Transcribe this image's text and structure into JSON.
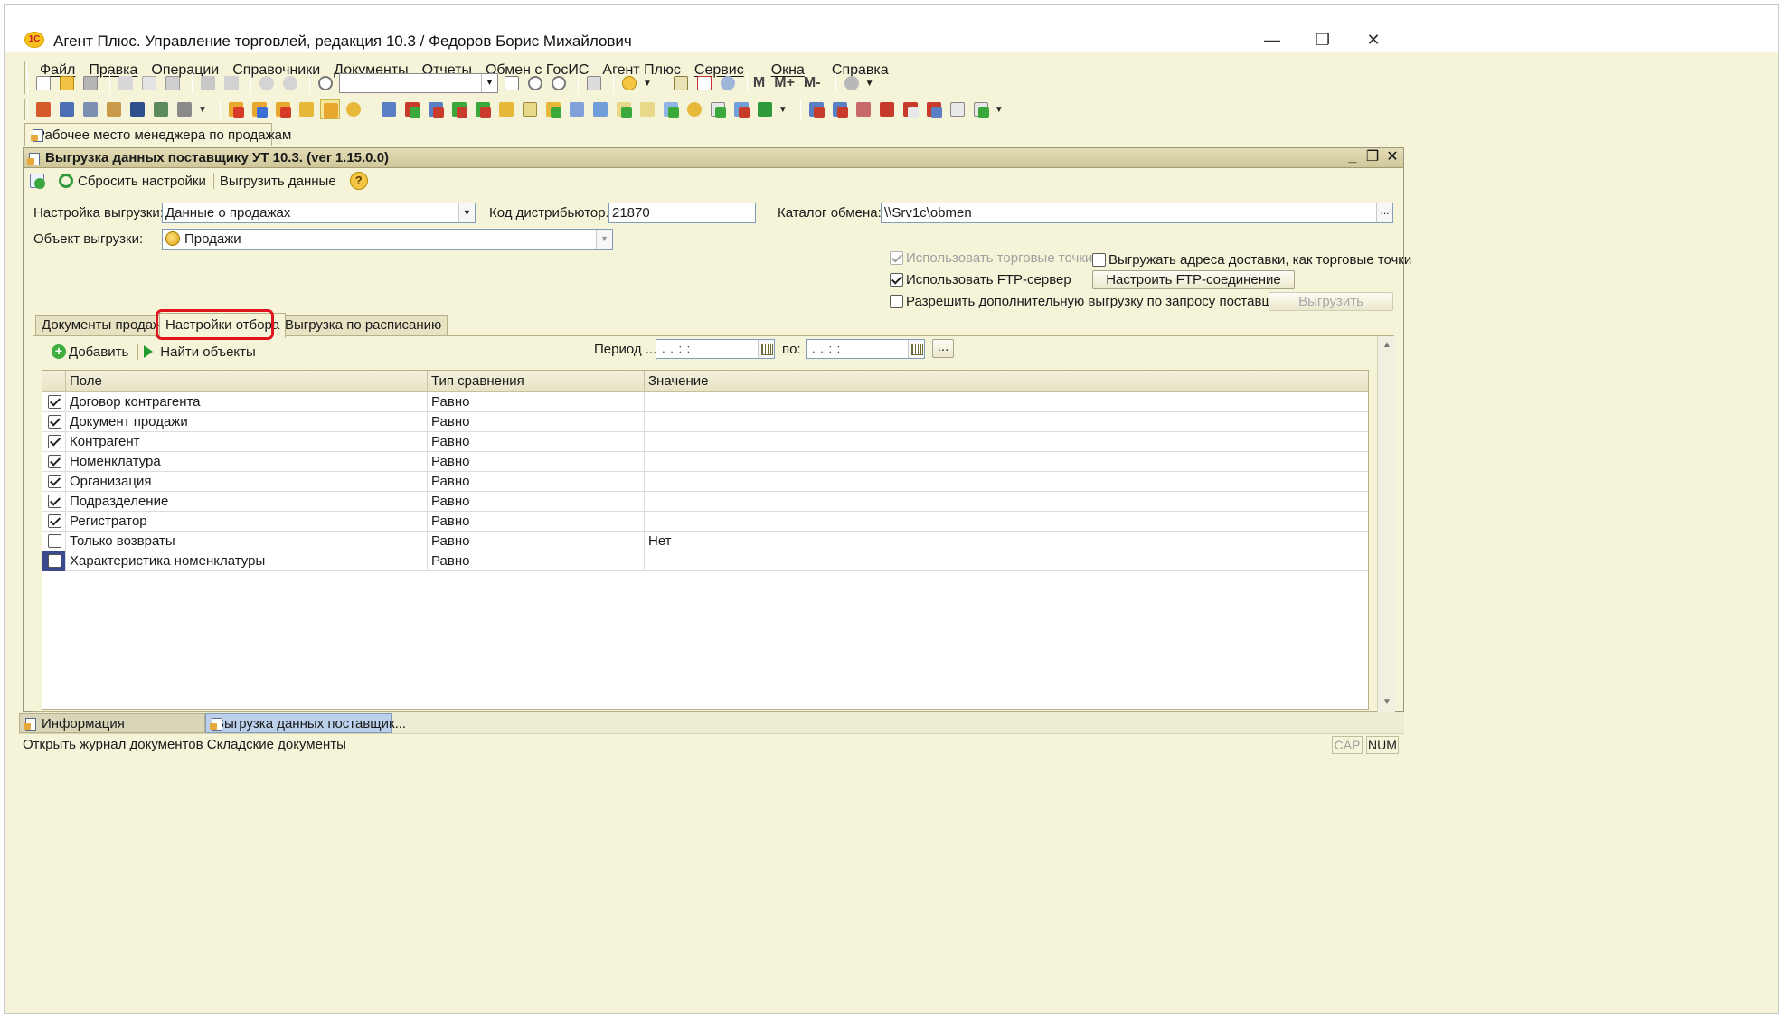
{
  "window": {
    "title": "Агент Плюс. Управление торговлей, редакция 10.3 / Федоров Борис Михайлович",
    "logo": "1С",
    "controls": {
      "minimize": "—",
      "restore": "❐",
      "close": "✕"
    }
  },
  "menu": [
    "Файл",
    "Правка",
    "Операции",
    "Справочники",
    "Документы",
    "Отчеты",
    "Обмен с ГосИС",
    "Агент Плюс",
    "Сервис",
    "Окна",
    "Справка"
  ],
  "toolbar": {
    "m_label": "M",
    "mplus_label": "M+",
    "mminus_label": "M-"
  },
  "open_window_tab": "Рабочее место менеджера по продажам",
  "form": {
    "title": "Выгрузка данных поставщику УТ 10.3. (ver 1.15.0.0)",
    "header_controls": {
      "minimize": "_",
      "restore": "❐",
      "close": "✕"
    },
    "toolbar": {
      "reset": "Сбросить настройки",
      "export": "Выгрузить данные",
      "help": "?"
    },
    "settings": {
      "config_label": "Настройка выгрузки:",
      "config_value": "Данные о продажах",
      "distributor_label": "Код дистрибьютор...",
      "distributor_value": "21870",
      "catalog_label": "Каталог обмена:",
      "catalog_value": "\\\\Srv1c\\obmen",
      "object_label": "Объект выгрузки:",
      "object_value": "Продажи"
    },
    "options": {
      "use_trade_points": "Использовать торговые точки",
      "export_delivery": "Выгружать адреса доставки, как торговые точки",
      "use_ftp": "Использовать FTP-сервер",
      "ftp_button": "Настроить FTP-соединение",
      "allow_extra": "Разрешить дополнительную выгрузку по запросу поставщика",
      "export_button": "Выгрузить"
    },
    "tabs": [
      "Документы продаж",
      "Настройки отбора",
      "Выгрузка по расписанию"
    ],
    "filter": {
      "add": "Добавить",
      "find": "Найти объекты",
      "period_label": "Период ...",
      "to_label": "по:",
      "date_placeholder": " .  .     :  :",
      "more": "...",
      "columns": [
        "Поле",
        "Тип сравнения",
        "Значение"
      ],
      "rows": [
        {
          "field": "Договор контрагента",
          "compare": "Равно",
          "value": ""
        },
        {
          "field": "Документ продажи",
          "compare": "Равно",
          "value": ""
        },
        {
          "field": "Контрагент",
          "compare": "Равно",
          "value": ""
        },
        {
          "field": "Номенклатура",
          "compare": "Равно",
          "value": ""
        },
        {
          "field": "Организация",
          "compare": "Равно",
          "value": ""
        },
        {
          "field": "Подразделение",
          "compare": "Равно",
          "value": ""
        },
        {
          "field": "Регистратор",
          "compare": "Равно",
          "value": ""
        },
        {
          "field": "Только возвраты",
          "compare": "Равно",
          "value": "Нет"
        },
        {
          "field": "Характеристика номенклатуры",
          "compare": "Равно",
          "value": ""
        }
      ]
    }
  },
  "bottom_tabs": [
    "Информация",
    "Выгрузка данных поставщик..."
  ],
  "status": {
    "text": "Открыть журнал документов Складские документы",
    "cap": "CAP",
    "num": "NUM"
  },
  "colors": {
    "highlight": "#e0141e",
    "background": "#f5f3d8",
    "selection": "#3b4a8c"
  }
}
